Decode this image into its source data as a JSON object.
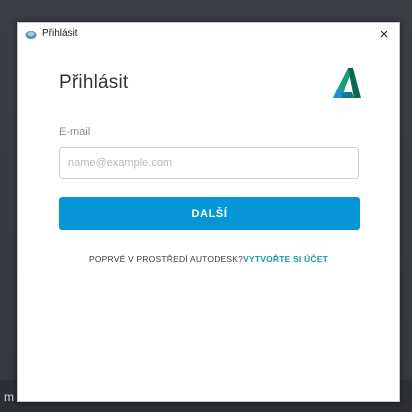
{
  "window": {
    "title": "Přihlásit",
    "close_icon": "×"
  },
  "login": {
    "heading": "Přihlásit",
    "email_label": "E-mail",
    "email_placeholder": "name@example.com",
    "email_value": "",
    "next_button": "DALŠÍ",
    "new_user_text": "POPRVÉ V PROSTŘEDÍ AUTODESK?",
    "create_account_link": "VYTVOŘTE SI ÚČET"
  },
  "background": {
    "bottom_text": "m"
  },
  "icons": {
    "app_icon": "autodesk-cloud-icon",
    "logo": "autodesk-logo",
    "close": "close-icon"
  },
  "colors": {
    "primary_button": "#0696d7",
    "link": "#1a9ba8",
    "logo_dark": "#0b6a52",
    "logo_mid": "#1a9e78",
    "logo_light": "#1c8fcf"
  }
}
